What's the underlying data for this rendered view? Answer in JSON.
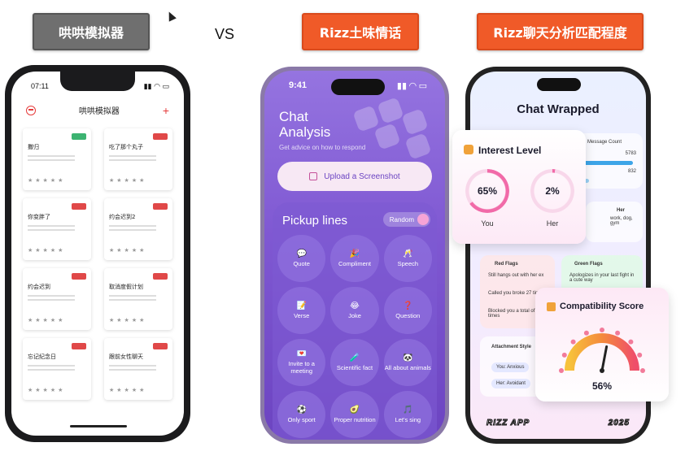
{
  "labels": {
    "left": "哄哄模拟器",
    "vs": "VS",
    "middle": "Rizz土味情话",
    "right": "Rizz聊天分析匹配程度"
  },
  "phone1": {
    "time": "07:11",
    "title": "哄哄模拟器",
    "cards": [
      {
        "title": "撒归",
        "badge": "green"
      },
      {
        "title": "吃了那个丸子",
        "badge": "red"
      },
      {
        "title": "你变胖了",
        "badge": "red"
      },
      {
        "title": "约会迟到2",
        "badge": "red"
      },
      {
        "title": "约会迟到",
        "badge": "red"
      },
      {
        "title": "取消度假计划",
        "badge": "red"
      },
      {
        "title": "忘记纪念日",
        "badge": "red"
      },
      {
        "title": "跟前女性聊天",
        "badge": "red"
      }
    ],
    "stars": "★★★★★"
  },
  "phone2": {
    "time": "9:41",
    "title": "Chat Analysis",
    "subtitle": "Get advice on how to respond",
    "upload_label": "Upload a Screenshot",
    "pickup_title": "Pickup lines",
    "random_label": "Random",
    "categories": [
      {
        "label": "Quote",
        "icon": "💬"
      },
      {
        "label": "Compliment",
        "icon": "🎉"
      },
      {
        "label": "Speech",
        "icon": "🥂"
      },
      {
        "label": "Verse",
        "icon": "📝"
      },
      {
        "label": "Joke",
        "icon": "😂"
      },
      {
        "label": "Question",
        "icon": "❓"
      },
      {
        "label": "Invite to a meeting",
        "icon": "💌"
      },
      {
        "label": "Scientific fact",
        "icon": "🧪"
      },
      {
        "label": "All about animals",
        "icon": "🐼"
      },
      {
        "label": "Only sport",
        "icon": "⚽"
      },
      {
        "label": "Proper nutrition",
        "icon": "🥑"
      },
      {
        "label": "Let's sing",
        "icon": "🎵"
      }
    ]
  },
  "phone3": {
    "title": "Chat Wrapped",
    "message_count_label": "Message Count",
    "count_1": "5783",
    "count_2": "832",
    "her_label": "Her",
    "her_sub": "work, dog, gym",
    "red_flags_title": "Red Flags",
    "red_flags": [
      "Still hangs out with her ex",
      "Called you broke 27 times",
      "Blocked you a total of 32 times"
    ],
    "green_flags_title": "Green Flags",
    "green_flags": [
      "Apologizes in your last fight in a cute way"
    ],
    "attachment_title": "Attachment Style",
    "you_style": "You: Anxious",
    "her_style": "Her: Avoidant",
    "footer_left": "RIZZ APP",
    "footer_right": "2025"
  },
  "interest": {
    "title": "Interest Level",
    "you_value": "65%",
    "her_value": "2%",
    "you_label": "You",
    "her_label": "Her",
    "you_pct": 65,
    "her_pct": 2
  },
  "compat": {
    "title": "Compatibility Score",
    "value": "56%",
    "pct": 56
  },
  "colors": {
    "orange_label": "#f05a28",
    "gray_label": "#6f6f6f",
    "purple": "#7f58d2",
    "pink": "#f16aa8"
  }
}
